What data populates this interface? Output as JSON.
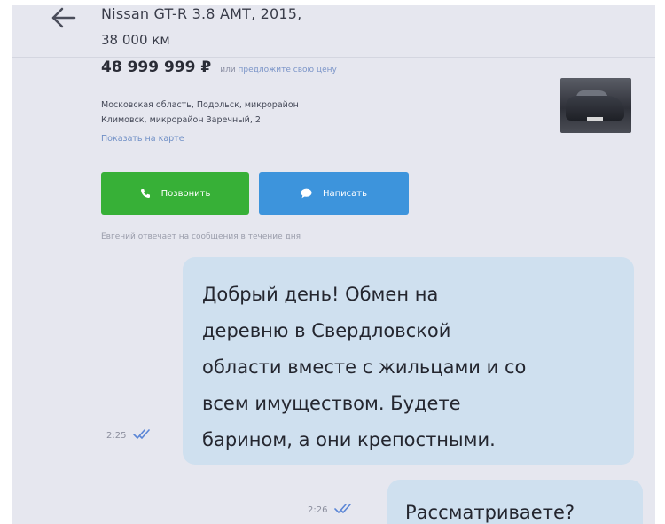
{
  "listing": {
    "title": "Nissan GT-R 3.8 AMT, 2015,",
    "mileage": "38 000 км",
    "price": "48 999 999 ₽",
    "price_alt_prefix": "или",
    "price_alt_link": "предложите свою цену",
    "address_line1": "Московская область, Подольск, микрорайон",
    "address_line2": "Климовск, микрорайон Заречный, 2",
    "map_link": "Показать на карте"
  },
  "actions": {
    "call_label": "Позвонить",
    "write_label": "Написать"
  },
  "seller": {
    "responds_note": "Евгений отвечает на сообщения в течение дня"
  },
  "messages": [
    {
      "time": "2:25",
      "lines": [
        "Добрый день! Обмен на",
        "деревню в Свердловской",
        "области вместе с жильцами и со",
        "всем имуществом. Будете",
        "барином, а они крепостными."
      ]
    },
    {
      "time": "2:26",
      "text": "Рассматриваете?"
    }
  ],
  "colors": {
    "call": "#37b037",
    "write": "#3d94dc",
    "bubble": "#cfe0ef",
    "link": "#6f8fc6",
    "check": "#5b86d6"
  },
  "icons": {
    "back": "arrow-left-icon",
    "call": "phone-icon",
    "write": "chat-bubble-icon",
    "read": "double-check-icon"
  }
}
